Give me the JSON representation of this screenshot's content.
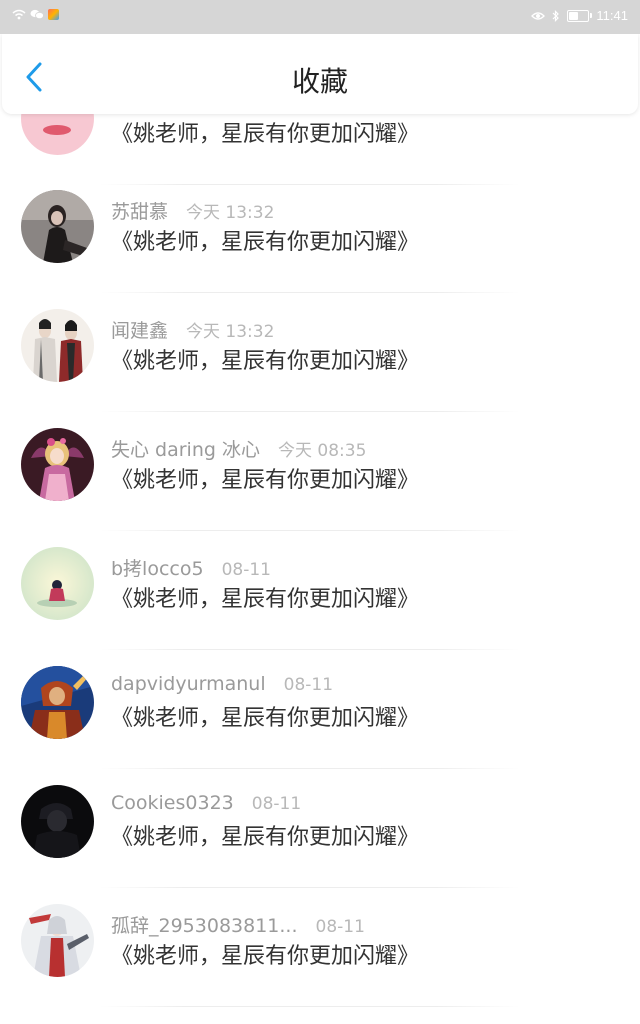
{
  "status_bar": {
    "time": "11:41",
    "battery_level": 0.45,
    "icons": [
      "wifi-icon",
      "wechat-icon",
      "app-icon",
      "eye-icon",
      "bluetooth-icon",
      "battery-icon"
    ]
  },
  "header": {
    "title": "收藏",
    "back_icon": "chevron-left-icon",
    "accent_color": "#1e9be9"
  },
  "favorites": [
    {
      "username": "",
      "time": "",
      "content": "《姚老师，星辰有你更加闪耀》",
      "avatar": "pink-avatar"
    },
    {
      "username": "苏甜慕",
      "time": "今天 13:32",
      "content": "《姚老师，星辰有你更加闪耀》",
      "avatar": "girl-photo-avatar"
    },
    {
      "username": "闻建鑫",
      "time": "今天 13:32",
      "content": "《姚老师，星辰有你更加闪耀》",
      "avatar": "ink-painting-avatar"
    },
    {
      "username": "失心 daring 冰心",
      "time": "今天 08:35",
      "content": "《姚老师，星辰有你更加闪耀》",
      "avatar": "anime-fairy-avatar"
    },
    {
      "username": "b拷locco5",
      "time": "08-11",
      "content": "《姚老师，星辰有你更加闪耀》",
      "avatar": "pastel-figure-avatar"
    },
    {
      "username": "dapvidyurmanul",
      "time": "08-11",
      "content": "《姚老师，星辰有你更加闪耀》",
      "avatar": "armored-hero-avatar"
    },
    {
      "username": "Cookies0323",
      "time": "08-11",
      "content": "《姚老师，星辰有你更加闪耀》",
      "avatar": "dark-silhouette-avatar"
    },
    {
      "username": "孤辞_2953083811...",
      "time": "08-11",
      "content": "《姚老师，星辰有你更加闪耀》",
      "avatar": "anime-warrior-avatar"
    }
  ]
}
